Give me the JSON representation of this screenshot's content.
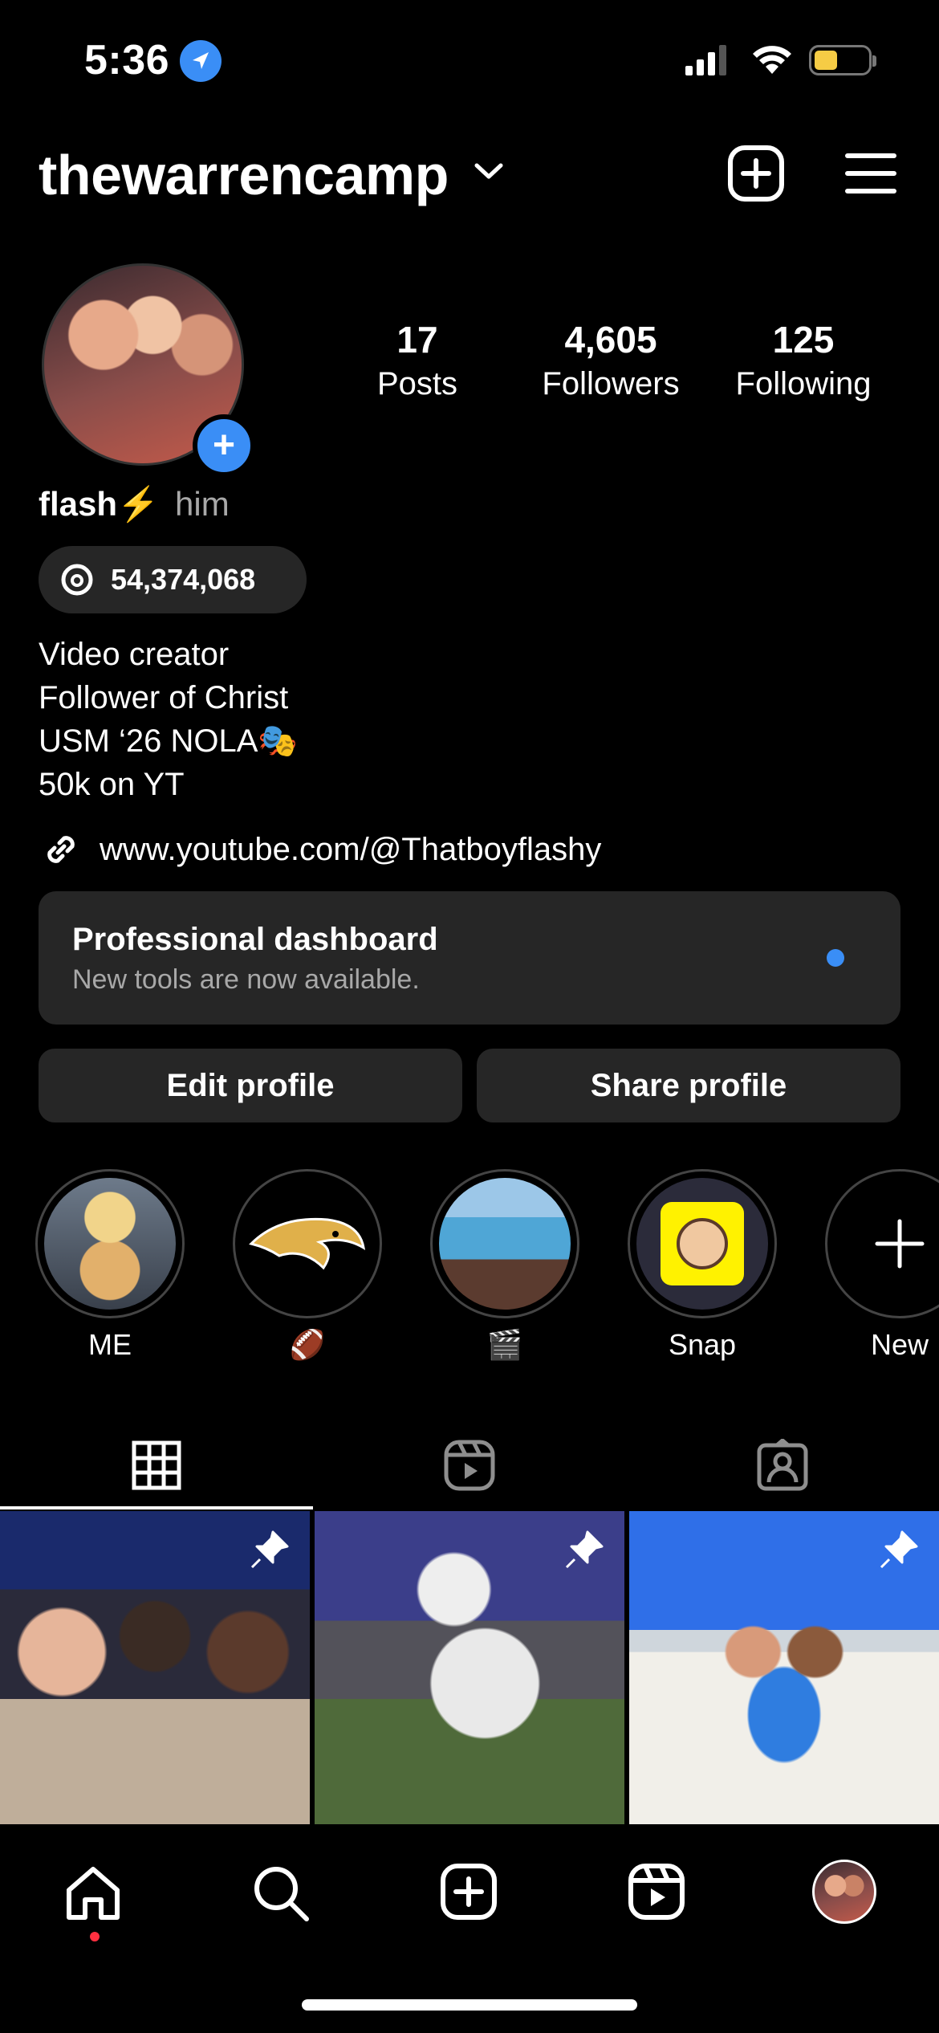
{
  "status_bar": {
    "time": "5:36",
    "battery_color": "#f6cc45"
  },
  "header": {
    "username": "thewarrencamp",
    "icons": [
      "chevron-down-icon",
      "add-post-icon",
      "menu-icon"
    ]
  },
  "profile": {
    "stats": [
      {
        "value": "17",
        "label": "Posts"
      },
      {
        "value": "4,605",
        "label": "Followers"
      },
      {
        "value": "125",
        "label": "Following"
      }
    ],
    "name": "flash⚡️",
    "pronouns": "him",
    "threads_count": "54,374,068",
    "bio": [
      "Video creator",
      "Follower of Christ",
      "USM ‘26 NOLA🎭",
      "50k on YT"
    ],
    "link": "www.youtube.com/@Thatboyflashy"
  },
  "dashboard": {
    "title": "Professional dashboard",
    "subtitle": "New tools are now available.",
    "dot_color": "#3a8ef6"
  },
  "buttons": {
    "edit": "Edit profile",
    "share": "Share profile"
  },
  "highlights": [
    {
      "label": "ME"
    },
    {
      "label": "🏈"
    },
    {
      "label": "🎬"
    },
    {
      "label": "Snap"
    },
    {
      "label": "New"
    }
  ],
  "tabs": [
    "grid-icon",
    "reels-icon",
    "tagged-icon"
  ],
  "bottom_nav": [
    "home-icon",
    "search-icon",
    "create-icon",
    "reels-icon",
    "profile-avatar"
  ],
  "accent_color": "#3a8ef6"
}
